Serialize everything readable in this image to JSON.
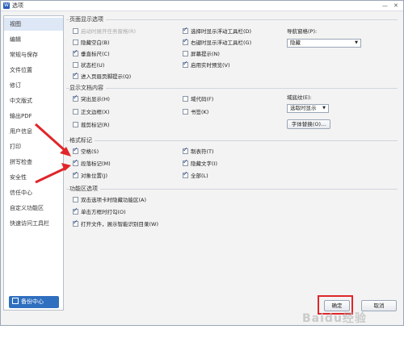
{
  "window": {
    "title": "选项",
    "app_icon": "W",
    "minimize": "—",
    "close": "✕"
  },
  "sidebar": {
    "items": [
      "视图",
      "编辑",
      "常规与保存",
      "文件位置",
      "修订",
      "中文版式",
      "输出PDF",
      "用户信息",
      "打印",
      "拼写检查",
      "安全性",
      "信任中心",
      "自定义功能区",
      "快速访问工具栏"
    ],
    "backup_label": "备份中心"
  },
  "page_display": {
    "title": "页面显示选项",
    "left": [
      {
        "label": "启动时展开任务窗格(R)",
        "checked": false,
        "disabled": true
      },
      {
        "label": "隐藏空白(B)",
        "checked": false
      },
      {
        "label": "垂直标尺(C)",
        "checked": true
      },
      {
        "label": "状态栏(U)",
        "checked": false
      },
      {
        "label": "进入页眉页脚提示(Q)",
        "checked": true
      }
    ],
    "right": [
      {
        "label": "选择时显示浮动工具栏(D)",
        "checked": true
      },
      {
        "label": "右键时显示浮动工具栏(G)",
        "checked": true
      },
      {
        "label": "屏幕提示(N)",
        "checked": false
      },
      {
        "label": "启用实时预览(V)",
        "checked": true
      }
    ],
    "nav_label": "导航窗格(P):",
    "nav_value": "隐藏"
  },
  "doc_content": {
    "title": "显示文档内容",
    "items": [
      {
        "label": "突出显示(H)",
        "checked": true
      },
      {
        "label": "域代码(F)",
        "checked": false
      },
      {
        "label": "正文边框(X)",
        "checked": false
      },
      {
        "label": "书签(K)",
        "checked": false
      },
      {
        "label": "裁剪标记(R)",
        "checked": false
      }
    ],
    "field_shading_label": "域底纹(E):",
    "field_shading_value": "选取时显示",
    "font_replace_button": "字体替换(O)..."
  },
  "format_marks": {
    "title": "格式标记",
    "items": [
      {
        "label": "空格(S)",
        "checked": true
      },
      {
        "label": "制表符(T)",
        "checked": true
      },
      {
        "label": "段落标记(M)",
        "checked": true
      },
      {
        "label": "隐藏文字(I)",
        "checked": true
      },
      {
        "label": "对象位置(J)",
        "checked": true
      },
      {
        "label": "全部(L)",
        "checked": true
      }
    ]
  },
  "ribbon_options": {
    "title": "功能区选项",
    "items": [
      {
        "label": "双击选项卡时隐藏功能区(A)",
        "checked": false
      },
      {
        "label": "单击方框时打勾(O)",
        "checked": true
      },
      {
        "label": "打开文件，展示智能识别目录(W)",
        "checked": true
      }
    ]
  },
  "footer": {
    "ok_label": "确定",
    "cancel_label": "取消"
  },
  "watermark": "Baidu经验",
  "colors": {
    "accent": "#2f6fbf",
    "highlight_box": "#e0262a",
    "arrows": "#e0262a"
  }
}
